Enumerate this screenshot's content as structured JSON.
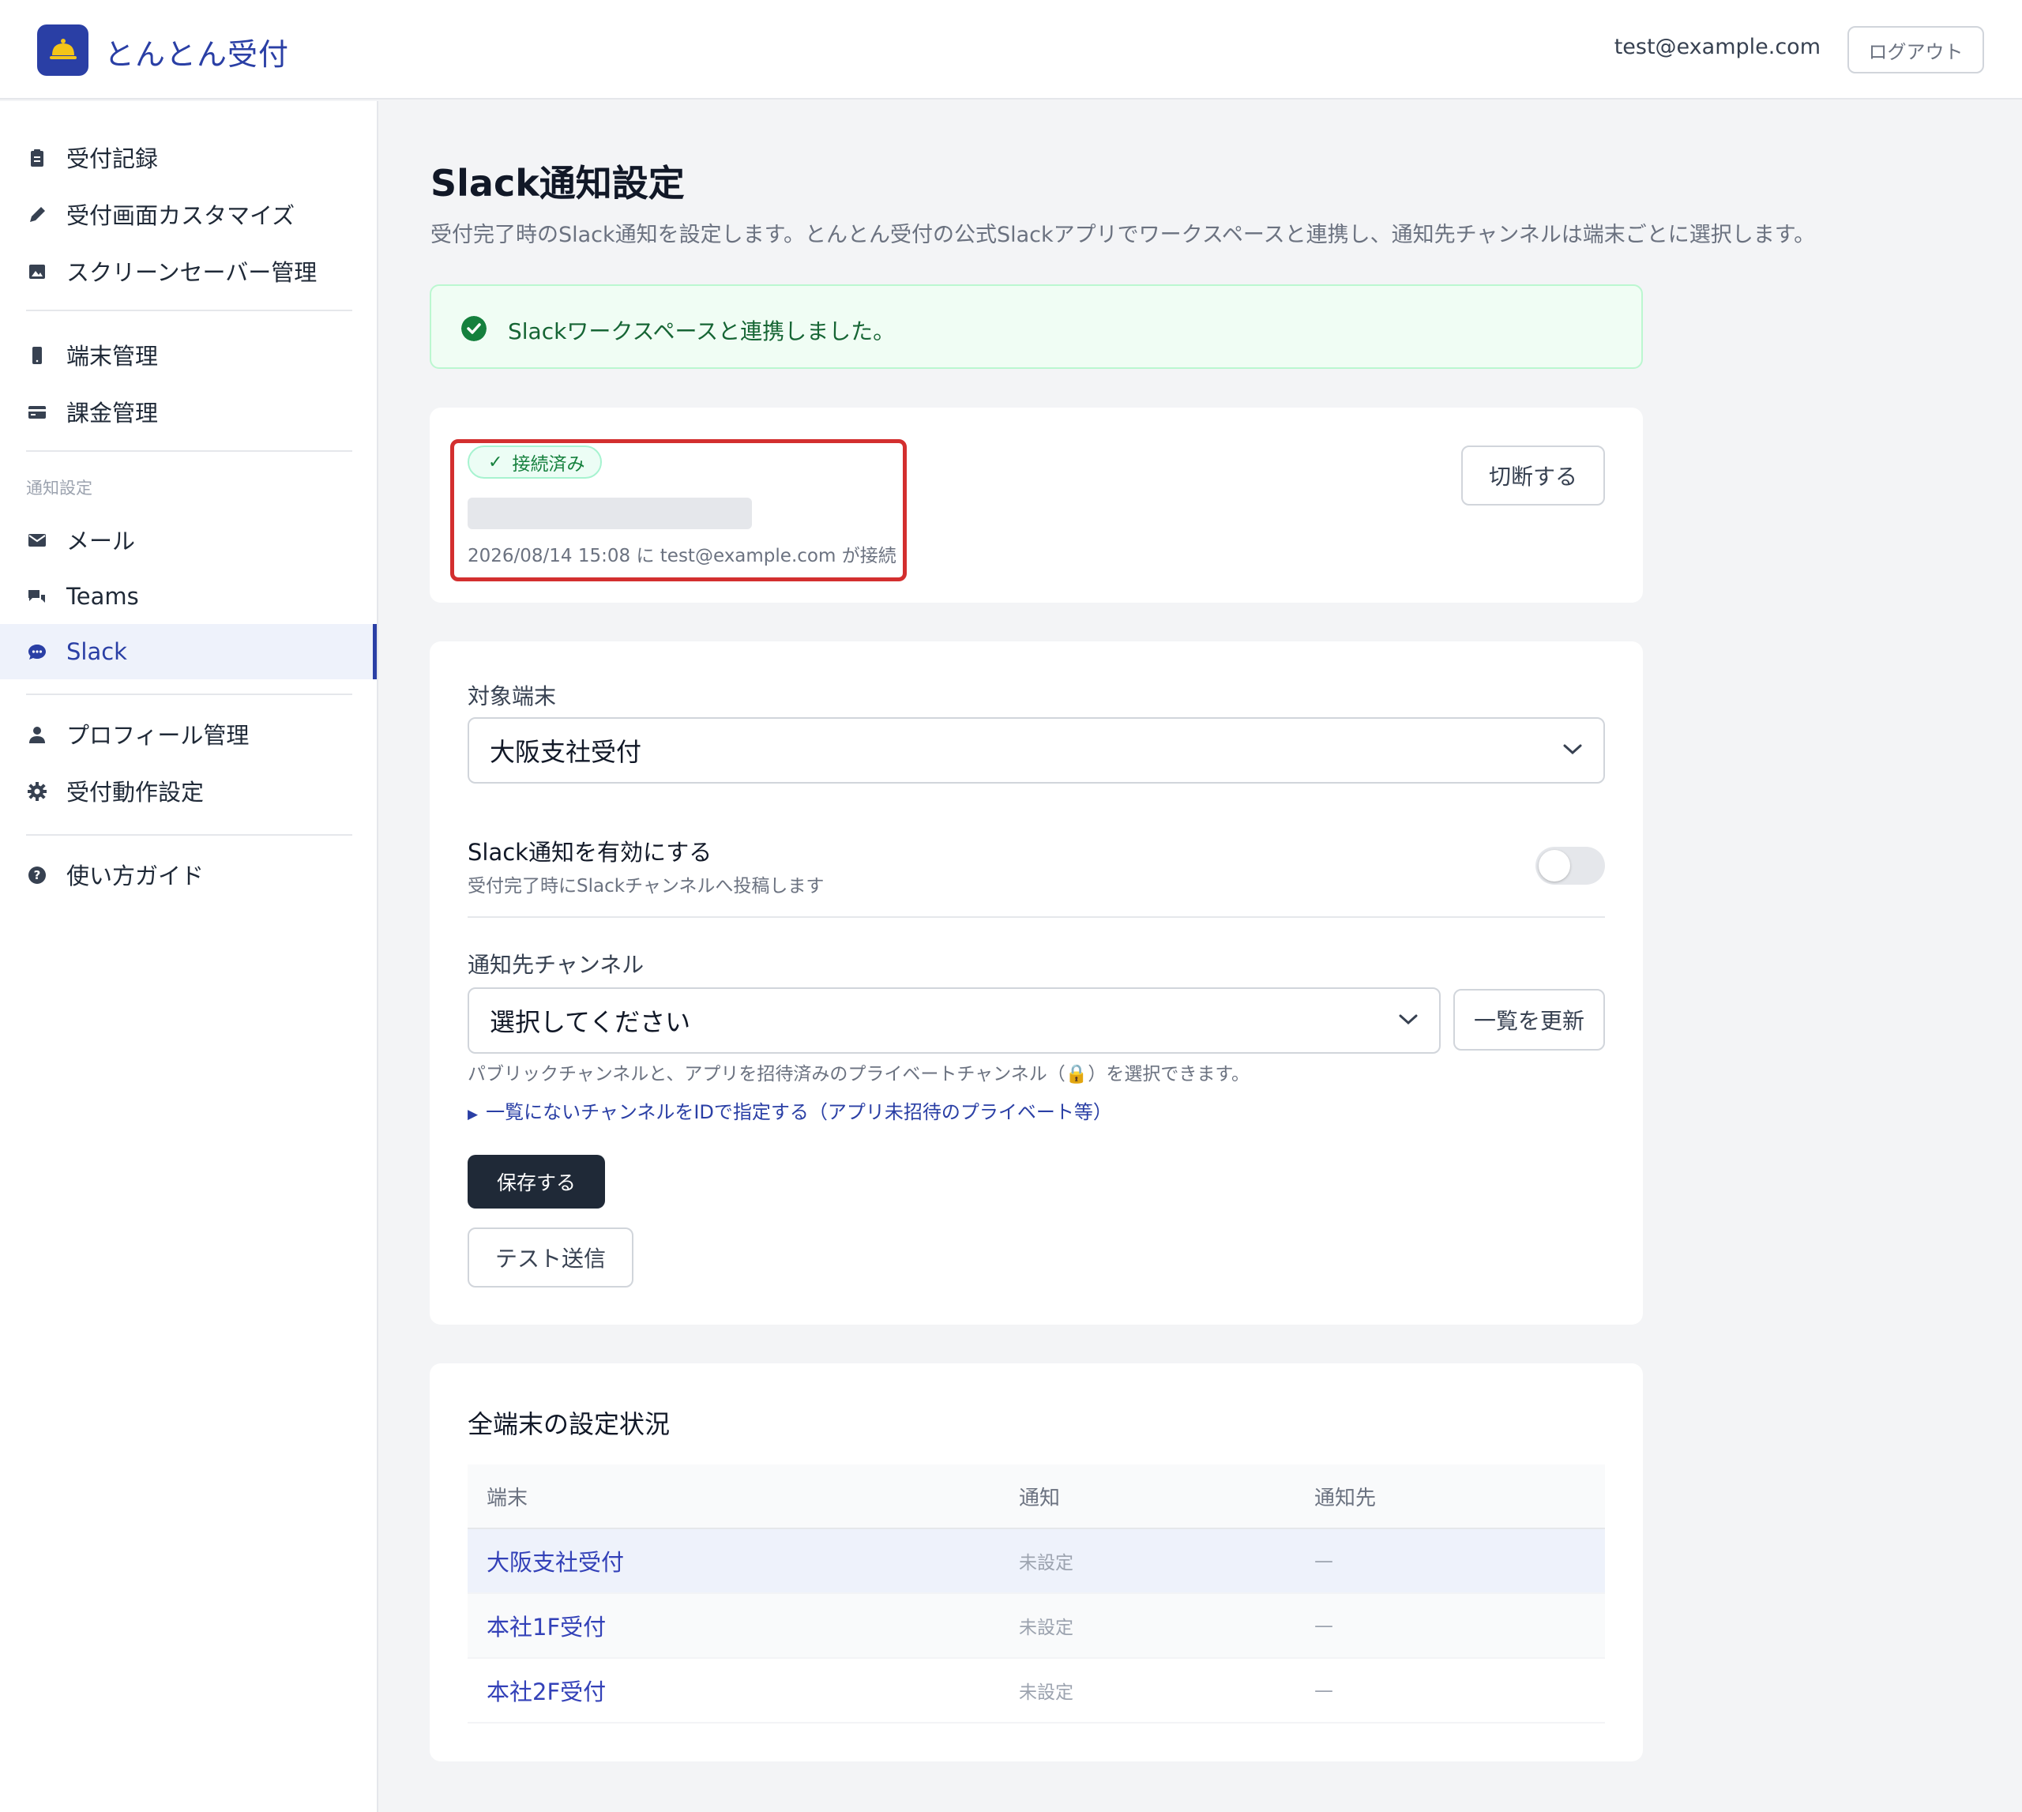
{
  "header": {
    "app_title": "とんとん受付",
    "user_email": "test@example.com",
    "logout_label": "ログアウト"
  },
  "sidebar": {
    "items": [
      {
        "label": "受付記録",
        "icon": "clipboard-icon"
      },
      {
        "label": "受付画面カスタマイズ",
        "icon": "pencil-icon"
      },
      {
        "label": "スクリーンセーバー管理",
        "icon": "image-icon"
      },
      {
        "label": "端末管理",
        "icon": "tablet-icon"
      },
      {
        "label": "課金管理",
        "icon": "credit-card-icon"
      },
      {
        "label": "メール",
        "icon": "mail-icon"
      },
      {
        "label": "Teams",
        "icon": "chat-bubbles-icon"
      },
      {
        "label": "Slack",
        "icon": "chat-dots-icon",
        "active": true
      },
      {
        "label": "プロフィール管理",
        "icon": "person-icon"
      },
      {
        "label": "受付動作設定",
        "icon": "gear-icon"
      },
      {
        "label": "使い方ガイド",
        "icon": "help-circle-icon"
      }
    ],
    "section_notification": "通知設定"
  },
  "page": {
    "title": "Slack通知設定",
    "description": "受付完了時のSlack通知を設定します。とんとん受付の公式Slackアプリでワークスペースと連携し、通知先チャンネルは端末ごとに選択します。"
  },
  "alert": {
    "text": "Slackワークスペースと連携しました。",
    "icon": "check-circle-icon"
  },
  "connection": {
    "badge": "接続済み",
    "connected_info": "2026/08/14 15:08 に test@example.com が接続",
    "disconnect_label": "切断する"
  },
  "settings": {
    "device_label": "対象端末",
    "device_value": "大阪支社受付",
    "enable_title": "Slack通知を有効にする",
    "enable_sub": "受付完了時にSlackチャンネルへ投稿します",
    "enabled": false,
    "channel_label": "通知先チャンネル",
    "channel_placeholder": "選択してください",
    "refresh_label": "一覧を更新",
    "help_text": "パブリックチャンネルと、アプリを招待済みのプライベートチャンネル（🔒）を選択できます。",
    "details_link": "一覧にないチャンネルをIDで指定する（アプリ未招待のプライベート等）",
    "save_label": "保存する",
    "test_label": "テスト送信"
  },
  "status_table": {
    "heading": "全端末の設定状況",
    "columns": [
      "端末",
      "通知",
      "通知先"
    ],
    "rows": [
      {
        "device": "大阪支社受付",
        "notify": "未設定",
        "dest": "—"
      },
      {
        "device": "本社1F受付",
        "notify": "未設定",
        "dest": "—"
      },
      {
        "device": "本社2F受付",
        "notify": "未設定",
        "dest": "—"
      }
    ]
  },
  "colors": {
    "brand": "#2a3fa5",
    "success": "#15803d",
    "highlight_border": "#d32f2f"
  }
}
